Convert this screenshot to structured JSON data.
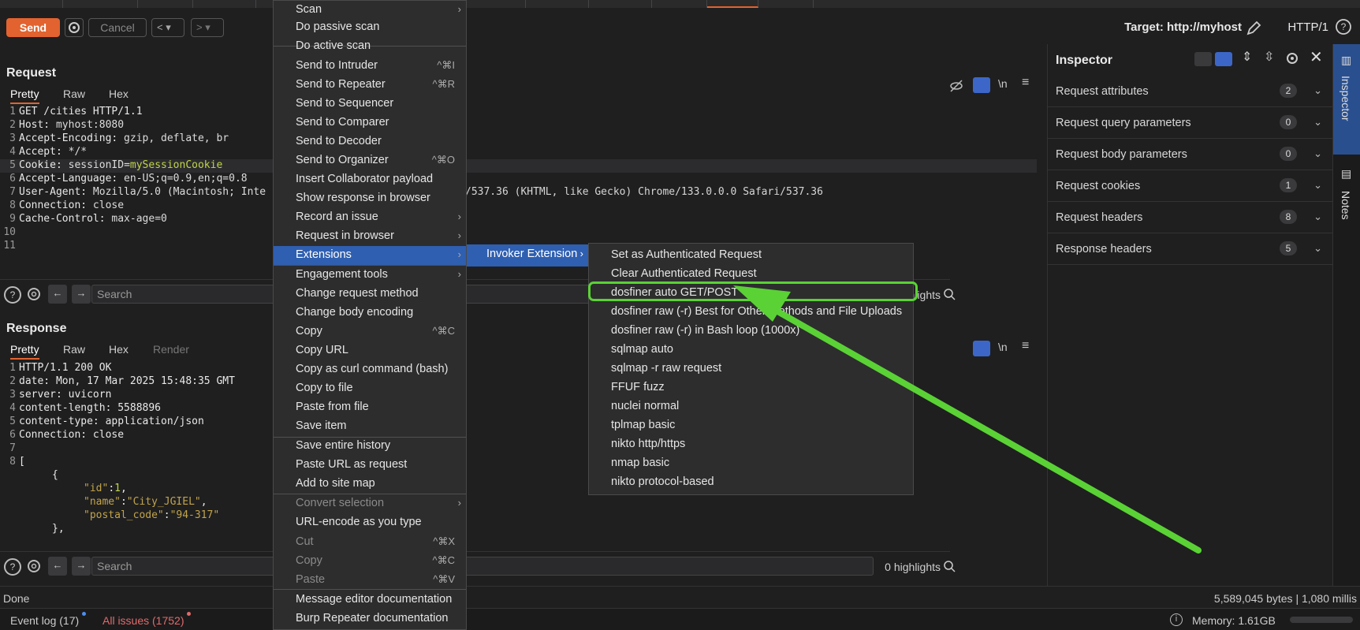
{
  "toolbar": {
    "send_label": "Send",
    "cancel_label": "Cancel",
    "prev_label": "<",
    "next_label": ">",
    "target": "Target: http://myhost",
    "http_version": "HTTP/1"
  },
  "request": {
    "title": "Request",
    "tabs": [
      "Pretty",
      "Raw",
      "Hex"
    ],
    "line_numbers": [
      "1",
      "2",
      "3",
      "4",
      "5",
      "6",
      "7",
      "8",
      "9",
      "10",
      "11"
    ],
    "lines": [
      {
        "k": "GET /cities HTTP/1.1",
        "v": ""
      },
      {
        "k": "Host:",
        "v": " myhost:8080"
      },
      {
        "k": "Accept-Encoding:",
        "v": " gzip, deflate, br"
      },
      {
        "k": "Accept:",
        "v": " */*"
      },
      {
        "k": "Cookie:",
        "v": " sessionID=",
        "cv": "mySessionCookie"
      },
      {
        "k": "Accept-Language:",
        "v": " en-US;q=0.9,en;q=0.8"
      },
      {
        "k": "User-Agent:",
        "v": " Mozilla/5.0 (Macintosh; Inte"
      },
      {
        "k": "Connection:",
        "v": " close"
      },
      {
        "k": "Cache-Control:",
        "v": " max-age=0"
      }
    ],
    "ua_tail": "/537.36 (KHTML, like Gecko) Chrome/133.0.0.0 Safari/537.36",
    "search_placeholder": "Search",
    "highlights": "0 highlights",
    "newline_label": "\\n"
  },
  "response": {
    "title": "Response",
    "tabs": [
      "Pretty",
      "Raw",
      "Hex",
      "Render"
    ],
    "line_numbers": [
      "1",
      "2",
      "3",
      "4",
      "5",
      "6",
      "7",
      "8"
    ],
    "header_lines": [
      "HTTP/1.1 200 OK",
      "date: Mon, 17 Mar 2025 15:48:35 GMT",
      "server: uvicorn",
      "content-length: 5588896",
      "content-type: application/json",
      "Connection: close",
      "",
      "["
    ],
    "json_open": "{",
    "id_key": "\"id\"",
    "id_val": "1",
    "name_key": "\"name\"",
    "name_val": "\"City_JGIEL\"",
    "postal_key": "\"postal_code\"",
    "postal_val": "\"94-317\"",
    "json_close": "},",
    "json_open2": "{",
    "search_placeholder": "Search",
    "highlights": "0 highlights",
    "newline_label": "\\n"
  },
  "context_menu": {
    "items": [
      {
        "label": "Scan",
        "shortcut": "",
        "submenu": true
      },
      {
        "label": "Do passive scan",
        "shortcut": ""
      },
      {
        "label": "Do active scan",
        "shortcut": ""
      },
      {
        "label": "Send to Intruder",
        "shortcut": "^⌘I"
      },
      {
        "label": "Send to Repeater",
        "shortcut": "^⌘R"
      },
      {
        "label": "Send to Sequencer",
        "shortcut": ""
      },
      {
        "label": "Send to Comparer",
        "shortcut": ""
      },
      {
        "label": "Send to Decoder",
        "shortcut": ""
      },
      {
        "label": "Send to Organizer",
        "shortcut": "^⌘O"
      },
      {
        "label": "Insert Collaborator payload",
        "shortcut": ""
      },
      {
        "label": "Show response in browser",
        "shortcut": ""
      },
      {
        "label": "Record an issue",
        "shortcut": "",
        "submenu": true
      },
      {
        "label": "Request in browser",
        "shortcut": "",
        "submenu": true
      },
      {
        "label": "Extensions",
        "shortcut": "",
        "submenu": true
      },
      {
        "label": "Engagement tools",
        "shortcut": "",
        "submenu": true
      },
      {
        "label": "Change request method",
        "shortcut": ""
      },
      {
        "label": "Change body encoding",
        "shortcut": ""
      },
      {
        "label": "Copy",
        "shortcut": "^⌘C"
      },
      {
        "label": "Copy URL",
        "shortcut": ""
      },
      {
        "label": "Copy as curl command (bash)",
        "shortcut": ""
      },
      {
        "label": "Copy to file",
        "shortcut": ""
      },
      {
        "label": "Paste from file",
        "shortcut": ""
      },
      {
        "label": "Save item",
        "shortcut": ""
      },
      {
        "label": "Save entire history",
        "shortcut": ""
      },
      {
        "label": "Paste URL as request",
        "shortcut": ""
      },
      {
        "label": "Add to site map",
        "shortcut": ""
      },
      {
        "label": "Convert selection",
        "shortcut": "",
        "submenu": true
      },
      {
        "label": "URL-encode as you type",
        "shortcut": ""
      },
      {
        "label": "Cut",
        "shortcut": "^⌘X"
      },
      {
        "label": "Copy",
        "shortcut": "^⌘C"
      },
      {
        "label": "Paste",
        "shortcut": "^⌘V"
      },
      {
        "label": "Message editor documentation",
        "shortcut": ""
      },
      {
        "label": "Burp Repeater documentation",
        "shortcut": ""
      }
    ]
  },
  "extensions_submenu": {
    "label": "Invoker Extension"
  },
  "invoker_items": [
    "Set as Authenticated Request",
    "Clear Authenticated Request",
    "dosfiner auto GET/POST",
    "dosfiner raw (-r) Best for Other methods and File Uploads",
    "dosfiner raw (-r) in Bash loop (1000x)",
    "sqlmap auto",
    "sqlmap -r raw request",
    "FFUF fuzz",
    "nuclei normal",
    "tplmap basic",
    "nikto http/https",
    "nmap basic",
    "nikto protocol-based"
  ],
  "inspector": {
    "title": "Inspector",
    "rows": [
      {
        "label": "Request attributes",
        "count": "2"
      },
      {
        "label": "Request query parameters",
        "count": "0"
      },
      {
        "label": "Request body parameters",
        "count": "0"
      },
      {
        "label": "Request cookies",
        "count": "1"
      },
      {
        "label": "Request headers",
        "count": "8"
      },
      {
        "label": "Response headers",
        "count": "5"
      }
    ]
  },
  "rail": {
    "inspector": "Inspector",
    "notes": "Notes"
  },
  "status": {
    "left": "Done",
    "right": "5,589,045 bytes | 1,080 millis"
  },
  "bottom": {
    "event_log": "Event log (17)",
    "all_issues": "All issues (1752)",
    "memory": "Memory: 1.61GB"
  },
  "colors": {
    "accent": "#e2632f",
    "selection": "#2f5fb0",
    "highlight_green": "#5ad235"
  }
}
